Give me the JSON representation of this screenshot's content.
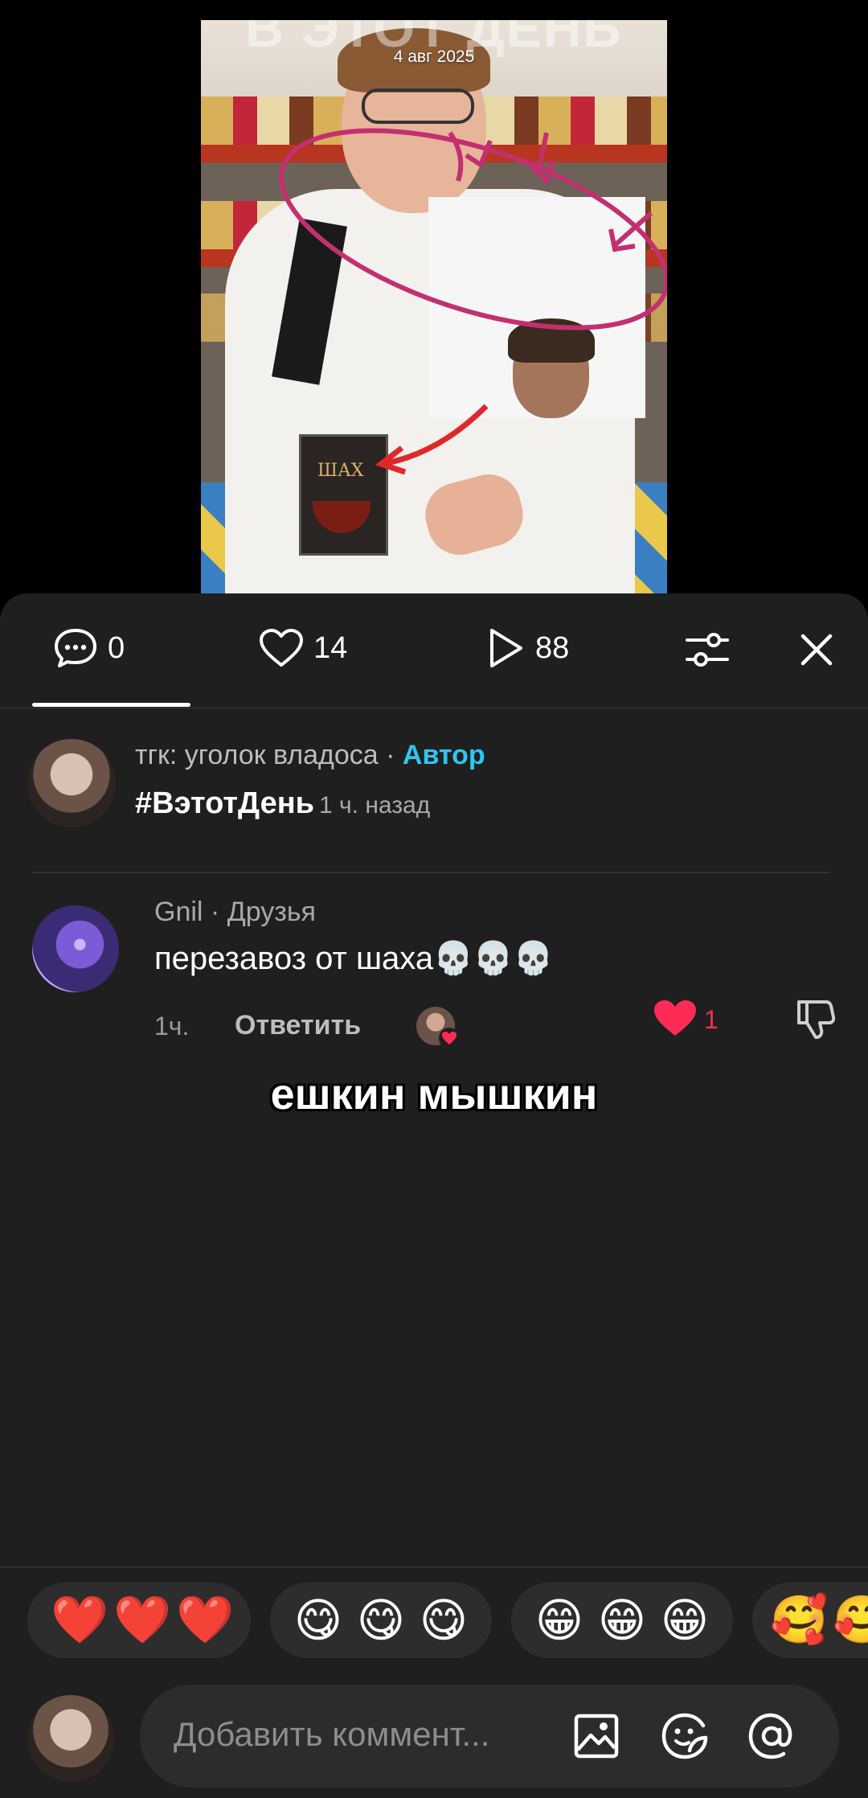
{
  "video": {
    "title": "В ЭТОТ ДЕНЬ",
    "date": "4 авг 2025",
    "box_text": "ШАХ"
  },
  "tabs": {
    "comments_count": "0",
    "likes_count": "14",
    "views_count": "88"
  },
  "post": {
    "author": "тгк: уголок владоса",
    "separator": " · ",
    "author_badge": "Автор",
    "hashtag": "#ВэтотДень",
    "time": "1 ч. назад"
  },
  "comment": {
    "user": "Gnil",
    "relation": "Друзья",
    "text": "перезавоз от шаха💀💀💀",
    "time": "1ч.",
    "reply_label": "Ответить",
    "like_count": "1"
  },
  "caption": "ешкин мышкин",
  "quick_reactions": [
    [
      "❤️",
      "❤️",
      "❤️"
    ],
    [
      "😋",
      "😋",
      "😋"
    ],
    [
      "😁",
      "😁",
      "😁"
    ],
    [
      "🥰",
      "🥰"
    ]
  ],
  "input": {
    "placeholder": "Добавить коммент..."
  },
  "colors": {
    "sheet_bg": "#1f1f1f",
    "author_badge": "#2fc6f0",
    "like_red": "#fe2c55"
  }
}
